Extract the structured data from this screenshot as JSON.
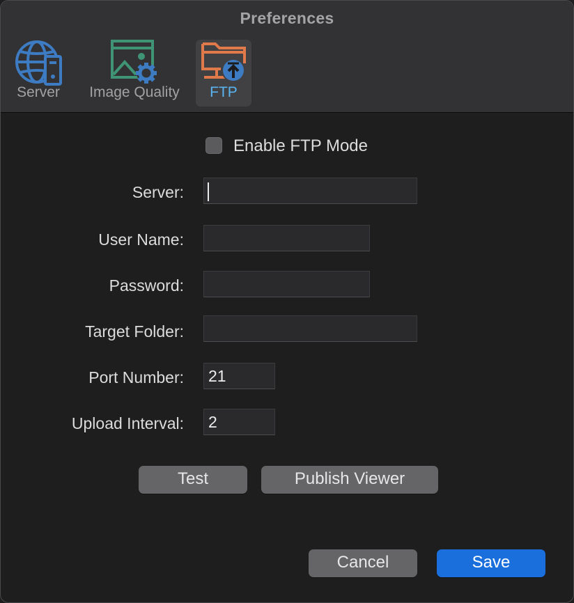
{
  "window": {
    "title": "Preferences"
  },
  "toolbar": {
    "tabs": [
      {
        "label": "Server",
        "icon": "globe-server-icon",
        "selected": false
      },
      {
        "label": "Image Quality",
        "icon": "image-gear-icon",
        "selected": false
      },
      {
        "label": "FTP",
        "icon": "folder-upload-icon",
        "selected": true
      }
    ]
  },
  "colors": {
    "server_icon": "#3d7bc2",
    "image_quality_icon": "#3e9474",
    "ftp_icon": "#e07a4a",
    "selected_tab_label": "#5ab4f0",
    "primary_button": "#1a6fdc"
  },
  "ftp": {
    "enable_label": "Enable FTP Mode",
    "enable_checked": false,
    "fields": [
      {
        "label": "Server:",
        "value": ""
      },
      {
        "label": "User Name:",
        "value": ""
      },
      {
        "label": "Password:",
        "value": ""
      },
      {
        "label": "Target Folder:",
        "value": ""
      },
      {
        "label": "Port Number:",
        "value": "21"
      },
      {
        "label": "Upload Interval:",
        "value": "2"
      }
    ],
    "test_label": "Test",
    "publish_label": "Publish Viewer"
  },
  "footer": {
    "cancel_label": "Cancel",
    "save_label": "Save"
  }
}
